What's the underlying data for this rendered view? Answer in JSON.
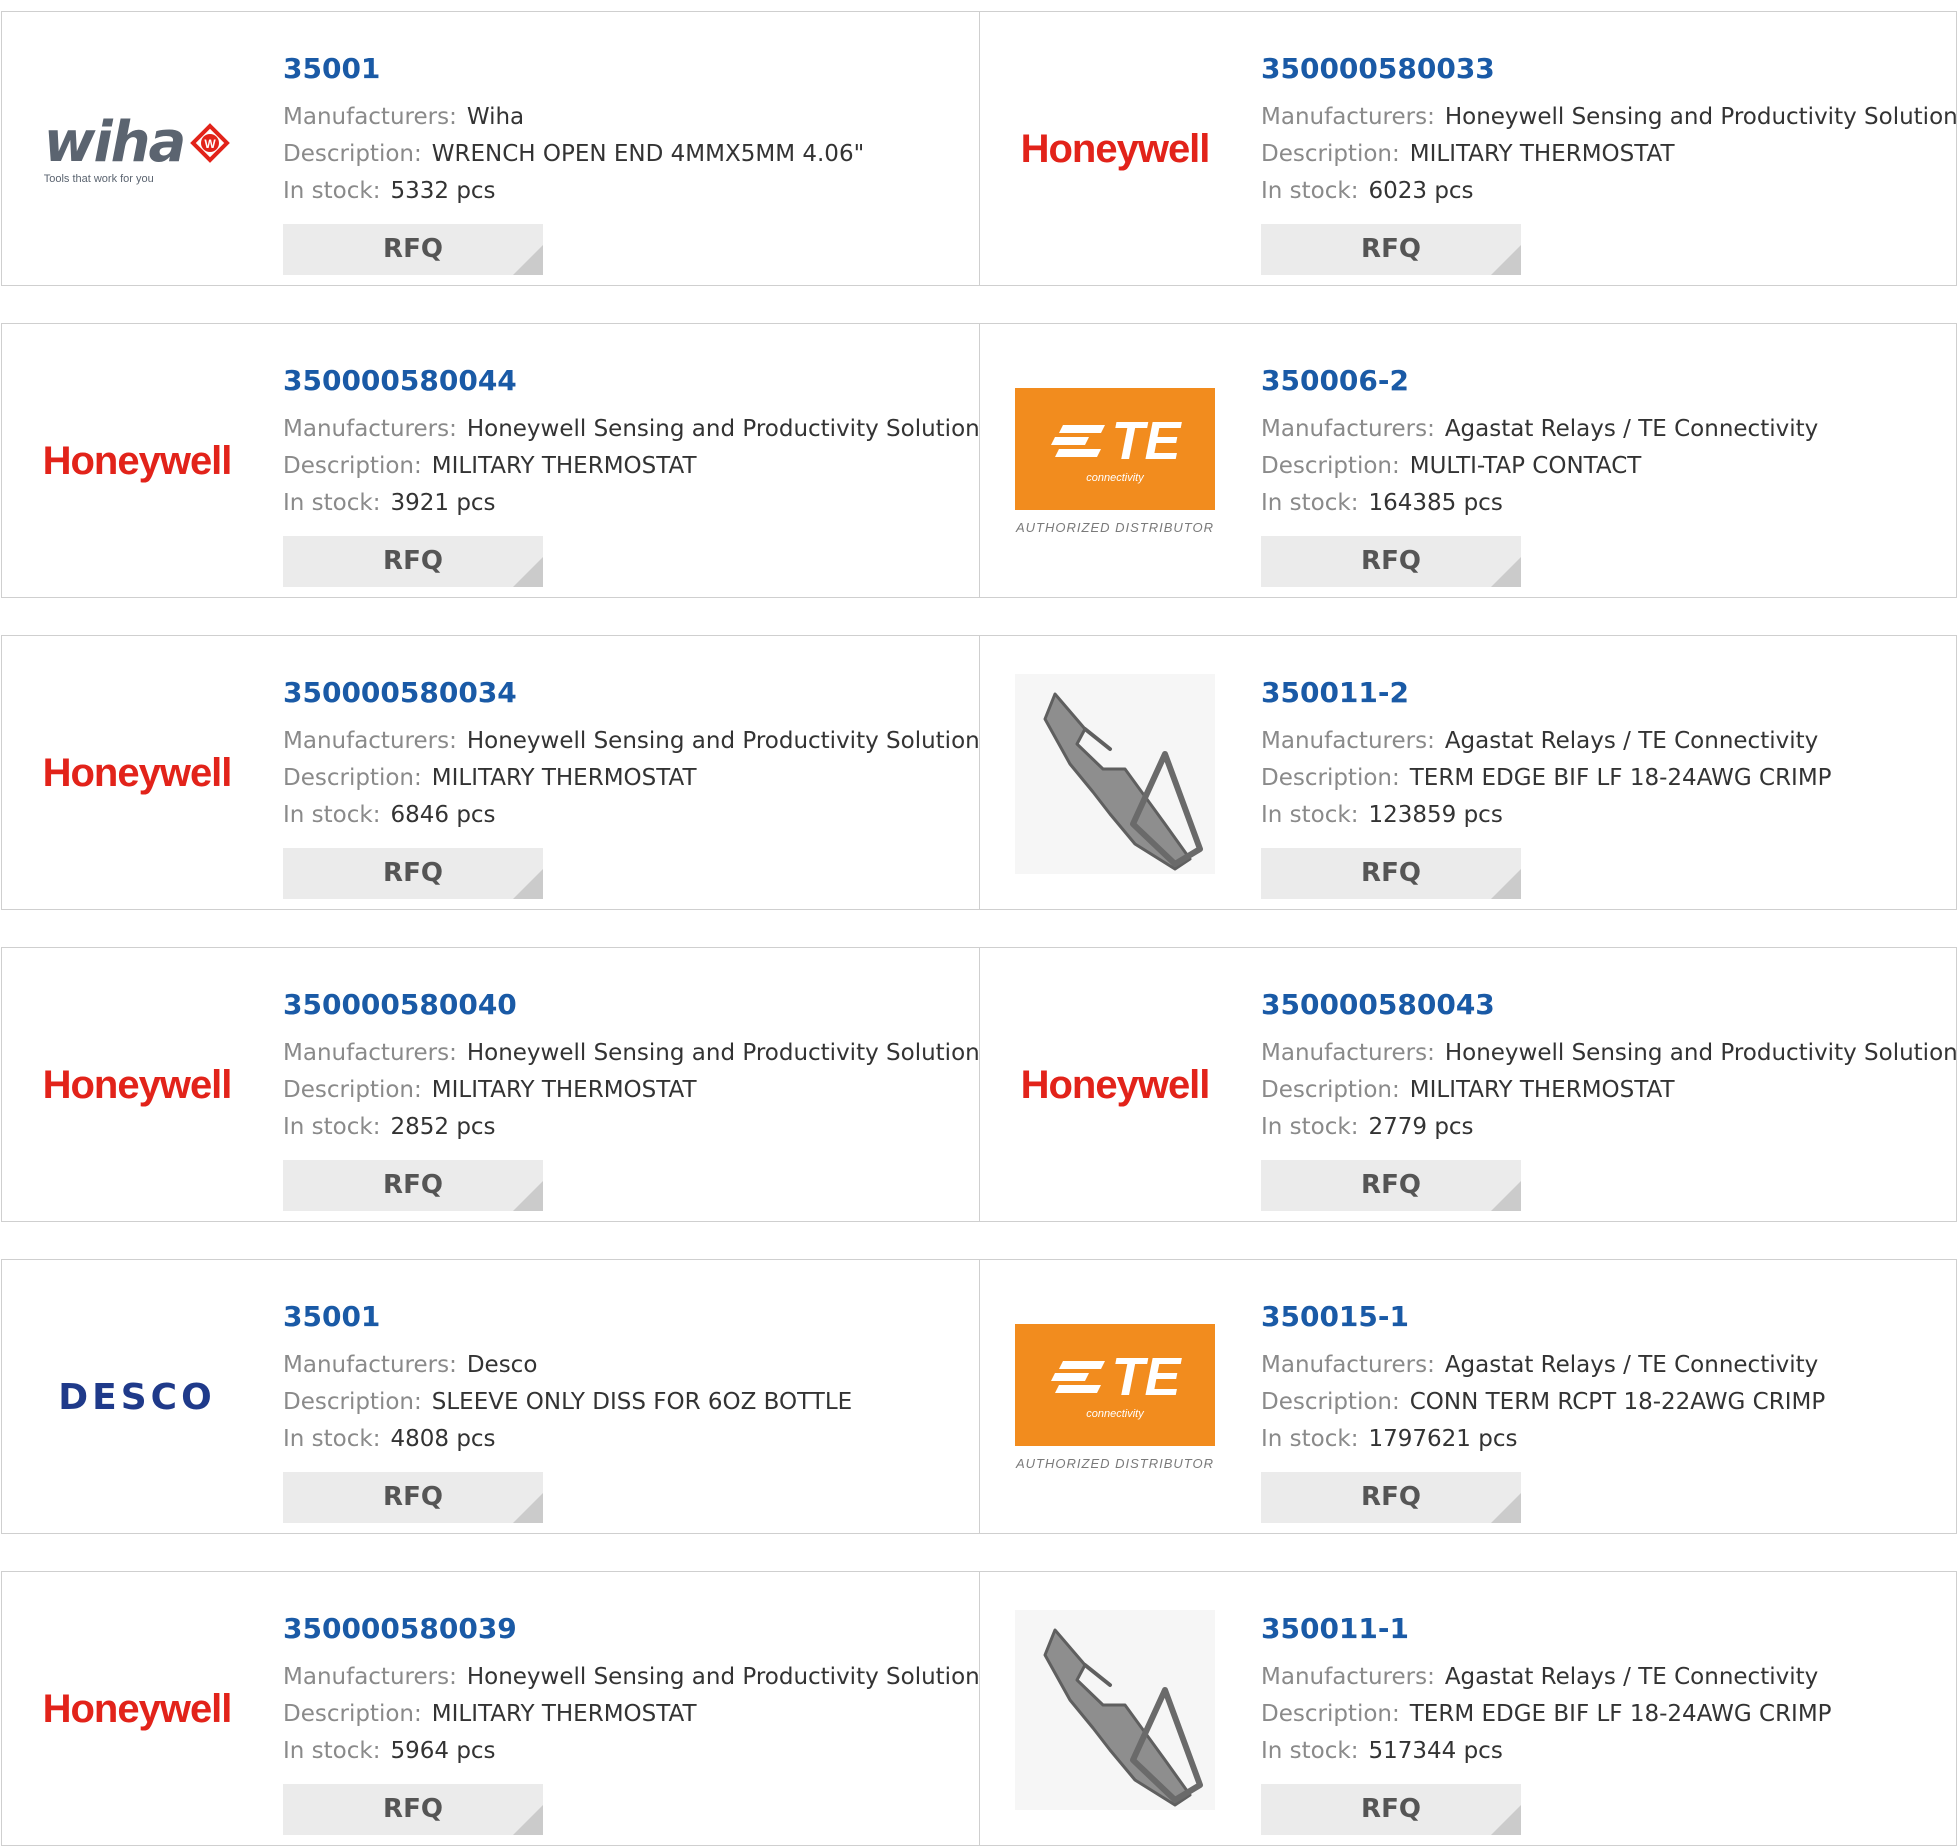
{
  "labels": {
    "manufacturers": "Manufacturers:",
    "description": "Description:",
    "in_stock": "In stock:",
    "rfq": "RFQ"
  },
  "colors": {
    "part_link": "#1a5aa6",
    "honeywell": "#e2231a",
    "te_orange": "#f28c1e",
    "desco": "#1f3a8a"
  },
  "logos": {
    "wiha": {
      "name": "wiha",
      "tagline": "Tools that work for you"
    },
    "honeywell": {
      "name": "Honeywell"
    },
    "te": {
      "name": "TE",
      "subtitle": "connectivity",
      "badge": "AUTHORIZED DISTRIBUTOR"
    },
    "desco": {
      "name": "DESCO"
    },
    "terminal": {
      "icon": "terminal-contact-photo"
    }
  },
  "rows": [
    {
      "left": {
        "part": "35001",
        "manufacturer": "Wiha",
        "description": "WRENCH OPEN END 4MMX5MM 4.06\"",
        "stock": "5332 pcs",
        "logo": "wiha"
      },
      "right": {
        "part": "350000580033",
        "manufacturer": "Honeywell Sensing and Productivity Solutions",
        "description": "MILITARY THERMOSTAT",
        "stock": "6023 pcs",
        "logo": "honeywell"
      }
    },
    {
      "left": {
        "part": "350000580044",
        "manufacturer": "Honeywell Sensing and Productivity Solutions",
        "description": "MILITARY THERMOSTAT",
        "stock": "3921 pcs",
        "logo": "honeywell"
      },
      "right": {
        "part": "350006-2",
        "manufacturer": "Agastat Relays / TE Connectivity",
        "description": "MULTI-TAP CONTACT",
        "stock": "164385 pcs",
        "logo": "te"
      }
    },
    {
      "left": {
        "part": "350000580034",
        "manufacturer": "Honeywell Sensing and Productivity Solutions",
        "description": "MILITARY THERMOSTAT",
        "stock": "6846 pcs",
        "logo": "honeywell"
      },
      "right": {
        "part": "350011-2",
        "manufacturer": "Agastat Relays / TE Connectivity",
        "description": "TERM EDGE BIF LF 18-24AWG CRIMP",
        "stock": "123859 pcs",
        "logo": "terminal"
      }
    },
    {
      "left": {
        "part": "350000580040",
        "manufacturer": "Honeywell Sensing and Productivity Solutions",
        "description": "MILITARY THERMOSTAT",
        "stock": "2852 pcs",
        "logo": "honeywell"
      },
      "right": {
        "part": "350000580043",
        "manufacturer": "Honeywell Sensing and Productivity Solutions",
        "description": "MILITARY THERMOSTAT",
        "stock": "2779 pcs",
        "logo": "honeywell"
      }
    },
    {
      "left": {
        "part": "35001",
        "manufacturer": "Desco",
        "description": "SLEEVE ONLY DISS FOR 6OZ BOTTLE",
        "stock": "4808 pcs",
        "logo": "desco"
      },
      "right": {
        "part": "350015-1",
        "manufacturer": "Agastat Relays / TE Connectivity",
        "description": "CONN TERM RCPT 18-22AWG CRIMP",
        "stock": "1797621 pcs",
        "logo": "te"
      }
    },
    {
      "left": {
        "part": "350000580039",
        "manufacturer": "Honeywell Sensing and Productivity Solutions",
        "description": "MILITARY THERMOSTAT",
        "stock": "5964 pcs",
        "logo": "honeywell"
      },
      "right": {
        "part": "350011-1",
        "manufacturer": "Agastat Relays / TE Connectivity",
        "description": "TERM EDGE BIF LF 18-24AWG CRIMP",
        "stock": "517344 pcs",
        "logo": "terminal"
      }
    }
  ]
}
